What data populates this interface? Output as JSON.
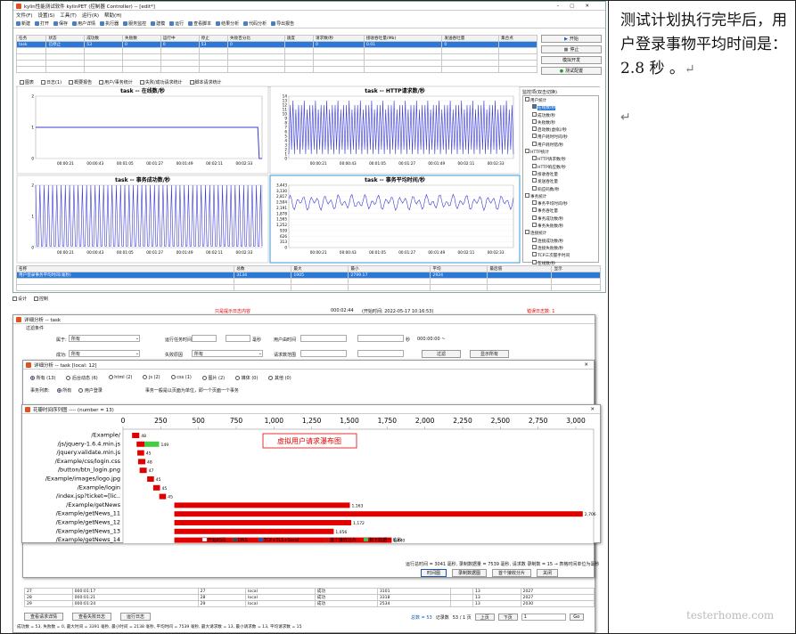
{
  "note": {
    "text": "测试计划执行完毕后，用户登录事物平均时间是： 2.8 秒 。",
    "mark": "↵",
    "mark2": "↵"
  },
  "main_window": {
    "title": "kylin性能测试软件 kylinPET (控制器 Controller) -- [edit*]",
    "menus": [
      "文件(F)",
      "设置(S)",
      "工具(T)",
      "运行(R)",
      "帮助(H)"
    ],
    "toolbar": [
      "新建",
      "打开",
      "保存",
      "用户详情",
      "执行器",
      "服务监控",
      "建模",
      "运行",
      "查看脚本",
      "结果分析",
      "代码分析",
      "导出报告"
    ],
    "status_columns": [
      "任务",
      "状态",
      "成功数",
      "失败数",
      "运行中",
      "停止",
      "失败百分比",
      "速度",
      "请求数/秒",
      "接收吞吐量(Mb)",
      "发送吞吐量",
      "集合点"
    ],
    "status_row": [
      "task",
      "已停止",
      "53",
      "0",
      "0",
      "53",
      "0",
      "",
      "0",
      "0.01",
      "0",
      ""
    ],
    "side_buttons": [
      "开始",
      "停止",
      "模拟开发",
      "测试配置"
    ],
    "tabs": [
      "图表",
      "日志(1)",
      "概要报告",
      "用户/事务统计",
      "失败/成功请求统计",
      "脚本请求统计"
    ]
  },
  "chart_data": [
    {
      "type": "line",
      "title": "task -- 在线数/秒",
      "ylim": [
        0,
        2
      ],
      "yticks": [
        "2",
        "1",
        "0"
      ],
      "xticks": [
        "00:00:21",
        "00:00:43",
        "00:01:05",
        "00:01:27",
        "00:01:49",
        "00:02:11",
        "00:02:33"
      ],
      "description_y": 1
    },
    {
      "type": "line",
      "title": "task -- HTTP请求数/秒",
      "ylim": [
        0,
        14
      ],
      "yticks": [
        "14",
        "13",
        "12",
        "11",
        "10",
        "9",
        "8",
        "7",
        "6",
        "5",
        "4",
        "3",
        "2",
        "1",
        "0"
      ],
      "xticks": [
        "00:00:21",
        "00:00:43",
        "00:01:05",
        "00:01:27",
        "00:01:49",
        "00:02:11",
        "00:02:33"
      ]
    },
    {
      "type": "line",
      "title": "task -- 事务成功数/秒",
      "ylim": [
        0,
        2
      ],
      "yticks": [
        "2",
        "1",
        "0"
      ],
      "xticks": [
        "00:00:21",
        "00:00:43",
        "00:01:05",
        "00:01:27",
        "00:01:49",
        "00:02:11",
        "00:02:33"
      ]
    },
    {
      "type": "line",
      "title": "task -- 事务平均时间/秒",
      "ylim": [
        0,
        3443
      ],
      "yticks": [
        "3,443",
        "3,130",
        "2,817",
        "2,504",
        "2,191",
        "1,878",
        "1,565",
        "1,252",
        "939",
        "626",
        "313",
        "0"
      ],
      "xticks": [
        "00:00:21",
        "00:00:43",
        "00:01:05",
        "00:01:27",
        "00:01:49",
        "00:02:11",
        "00:02:33"
      ]
    },
    {
      "type": "bar",
      "title": "花瓣时间序列图 ---- (number = 13)",
      "annotation": "虚拟用户请求瀑布图",
      "xticks": [
        "0",
        "250",
        "500",
        "750",
        "1,000",
        "1,250",
        "1,500",
        "1,750",
        "2,000",
        "2,250",
        "2,500",
        "2,750",
        "3,000"
      ],
      "categories": [
        "/Example/",
        "/js/jquery-1.6.4.min.js",
        "/jquery.validate.min.js",
        "/Example/css/login.css",
        "/button/btn_login.png",
        "/Example/images/logo.jpg",
        "/Example/login",
        "/index.jsp?ticket=[lic..",
        "/Example/getNews",
        "/Example/getNews_11",
        "/Example/getNews_12",
        "/Example/getNews_13",
        "/Example/getNews_14"
      ],
      "starts": [
        60,
        90,
        95,
        100,
        110,
        160,
        200,
        240,
        340,
        340,
        340,
        340,
        340
      ],
      "durations": [
        48,
        149,
        45,
        48,
        47,
        45,
        45,
        45,
        1163,
        2706,
        1172,
        1056,
        1440
      ],
      "labels": [
        "48",
        "149",
        "45",
        "48",
        "47",
        "45",
        "45",
        "45",
        "1,163",
        "2,706",
        "1,172",
        "1,056",
        "1,440"
      ],
      "legend": [
        "开始时间",
        "DNS",
        "TCP+TLS+Send",
        "首个接收分片",
        "剩下数据一 临秒"
      ]
    }
  ],
  "monitor": {
    "title": "监控项(双击切换)",
    "items": [
      "用户统计",
      "在线数/秒",
      "成功数/秒",
      "失败数/秒",
      "启动数(虚拟)/秒",
      "用户耗时时间/秒",
      "用户耗时错/秒",
      "HTTP统计",
      "HTTP请求数/秒",
      "HTTP响应数/秒",
      "接收吞吐量",
      "发送吞吐量",
      "响应码数/秒",
      "事务统计",
      "事务平均时间/秒",
      "事务吞吐量",
      "事务成功数/秒",
      "事务失败数/秒",
      "连接统计",
      "连接成功数/秒",
      "连接失败数/秒",
      "TCP三次握手时间",
      "在线数/秒"
    ]
  },
  "summary": {
    "columns": [
      "名称",
      "总数",
      "最大",
      "最小",
      "平均",
      "最后值",
      "显示"
    ],
    "row": [
      "用户登录事务平均时间(毫秒)",
      "",
      "3134",
      "1905",
      "2799.17",
      "2924",
      ""
    ]
  },
  "bottom_tabs": [
    "设计",
    "控制"
  ],
  "status_line": {
    "hint": "只是提示日志内容",
    "elapsed": "000:02:44",
    "start": "(开始时间: 2022-05-17 10:16:53)",
    "errors": "错误日志数: 1"
  },
  "analysis": {
    "title": "详细分析 -- task",
    "filter": "过滤条件",
    "group_label": "属于:",
    "group_value": "所有",
    "success_label": "成功:",
    "success_value": "所有",
    "runtime_label": "运行任务时间",
    "sec": "毫秒",
    "user_time_label": "用户由时间",
    "sec2": "秒",
    "time_placeholder": "000:00:00 ~",
    "endpoint_label": "失败原因",
    "endpoint_value": "所有",
    "req_label": "请求数范围",
    "filter_btn": "过滤",
    "all_btn": "显示所有"
  },
  "detail_dialog": {
    "title": "详细分析 -- task [local: 12]",
    "types": [
      "所有 (13)",
      "后台动态 (6)",
      "html (2)",
      "js (2)",
      "css (1)",
      "图片 (2)",
      "媒体 (0)",
      "其他 (0)"
    ],
    "list_label": "事务列表:",
    "list_opts": [
      "所有",
      "用户登录"
    ],
    "note": "事务一般是以页面为单位，即一个页面一个事务"
  },
  "bottom_panel": {
    "summary": "运行总时间 = 3041 毫秒, 录制数据量 = 7539 毫秒, 请求数 录制数 = 15 → 表格时间单位为毫秒",
    "buttons": [
      "时间图",
      "录制数据图",
      "首个接收分片",
      "关闭"
    ],
    "rows": [
      [
        "27",
        "000:01:17",
        "27",
        "local",
        "成功",
        "3101",
        "",
        "13",
        "2027"
      ],
      [
        "28",
        "000:01:21",
        "28",
        "local",
        "成功",
        "3318",
        "",
        "13",
        "2027"
      ],
      [
        "29",
        "000:01:24",
        "29",
        "local",
        "成功",
        "2534",
        "",
        "13",
        "2030"
      ]
    ],
    "nav_buttons": [
      "查看请求详情",
      "查看失败日志",
      "运行日志"
    ],
    "paging": {
      "total": "总数 = 53",
      "records": "记录数",
      "page": "53 / 1 页",
      "prev": "上页",
      "next": "下页",
      "page_input": "1",
      "go": "Go"
    },
    "footer": "成功数 = 53, 失败数 = 0, 最大时间 = 3391 毫秒, 最小时间 = 2138 毫秒, 平均时间 = 7539 毫秒, 最大请求数 = 13, 最小请求数 = 13, 平均请求数 = 15"
  },
  "watermark": "testerhome.com"
}
